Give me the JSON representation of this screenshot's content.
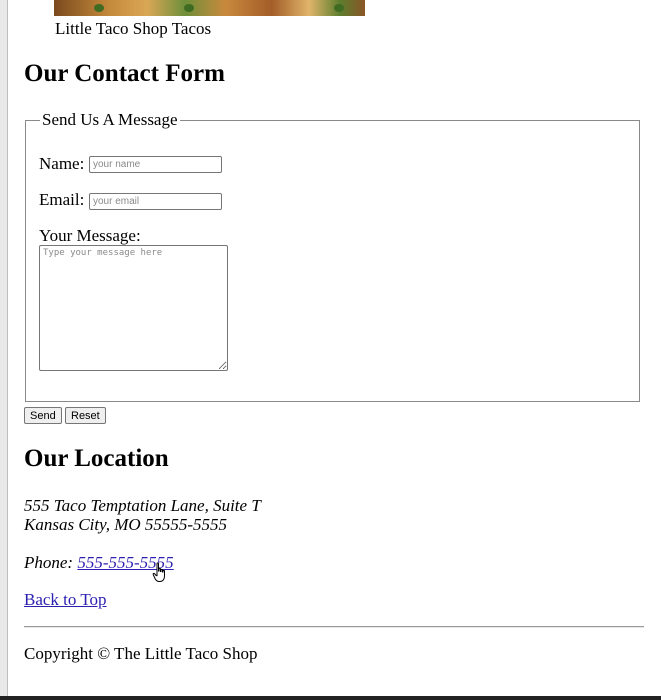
{
  "image": {
    "caption": "Little Taco Shop Tacos"
  },
  "contact": {
    "title": "Our Contact Form",
    "legend": "Send Us A Message",
    "name_label": "Name:",
    "name_placeholder": "your name",
    "email_label": "Email:",
    "email_placeholder": "your email",
    "message_label": "Your Message:",
    "message_placeholder": "Type your message here",
    "send_label": "Send",
    "reset_label": "Reset"
  },
  "location": {
    "title": "Our Location",
    "address_line1": "555 Taco Temptation Lane, Suite T",
    "address_line2": "Kansas City, MO 55555-5555",
    "phone_label": "Phone:",
    "phone_number": "555-555-5555"
  },
  "nav": {
    "back_to_top": "Back to Top"
  },
  "footer": {
    "copyright": "Copyright © The Little Taco Shop"
  },
  "colors": {
    "link": "#2a1fb0",
    "border": "#8a8a8a"
  }
}
